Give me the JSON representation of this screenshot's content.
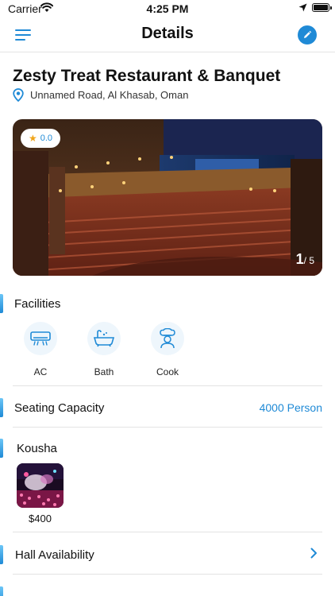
{
  "status_bar": {
    "carrier": "Carrier",
    "time": "4:25 PM",
    "battery_level": 1.0
  },
  "nav": {
    "title": "Details",
    "menu_icon": "hamburger-menu-icon",
    "edit_icon": "pencil-icon"
  },
  "venue": {
    "name": "Zesty Treat Restaurant & Banquet",
    "address": "Unnamed Road, Al Khasab, Oman",
    "rating": "0.0",
    "photo_index": "1",
    "photo_total": "/ 5"
  },
  "facilities": {
    "title": "Facilities",
    "items": [
      {
        "label": "AC",
        "icon": "air-conditioner-icon"
      },
      {
        "label": "Bath",
        "icon": "bathtub-icon"
      },
      {
        "label": "Cook",
        "icon": "chef-icon"
      }
    ]
  },
  "seating": {
    "label": "Seating Capacity",
    "value": "4000 Person"
  },
  "kousha": {
    "title": "Kousha",
    "price": "$400"
  },
  "availability": {
    "label": "Hall Availability"
  },
  "colors": {
    "accent": "#1f8ad6",
    "accent_light": "#6cc6f7",
    "star": "#f0a419"
  }
}
